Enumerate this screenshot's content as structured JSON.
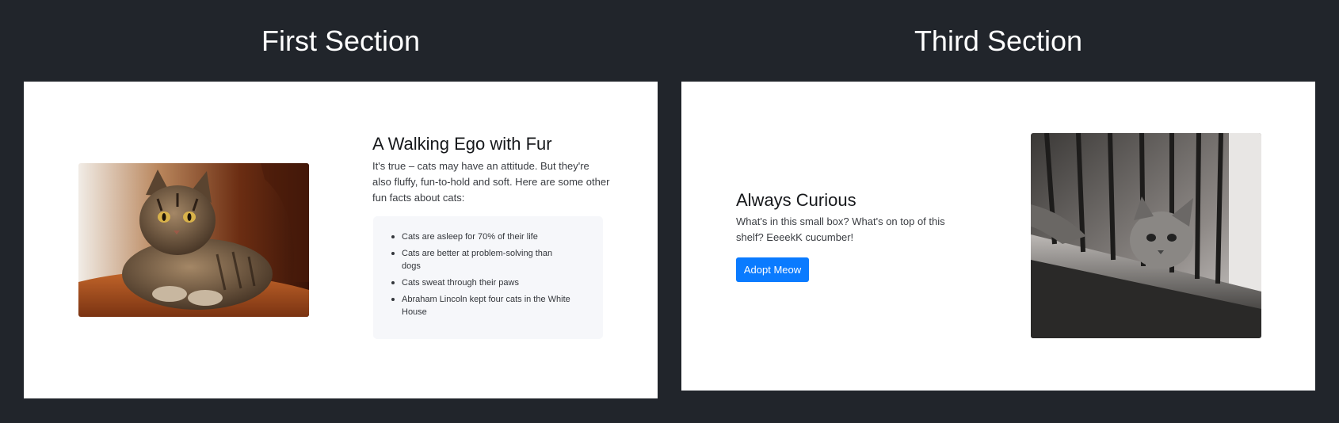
{
  "sections": {
    "first": {
      "title": "First Section",
      "image_icon": "tabby-cat-photo",
      "heading": "A Walking Ego with Fur",
      "paragraph": "It's true – cats may have an attitude. But they're also fluffy, fun-to-hold and soft. Here are some other fun facts about cats:",
      "facts": [
        "Cats are asleep for 70% of their life",
        "Cats are better at problem-solving than dogs",
        "Cats sweat through their paws",
        "Abraham Lincoln kept four cats in the White House"
      ]
    },
    "third": {
      "title": "Third Section",
      "image_icon": "balcony-cat-photo",
      "heading": "Always Curious",
      "paragraph": "What's in this small box? What's on top of this shelf? EeeekK cucumber!",
      "button_label": "Adopt Meow"
    }
  },
  "colors": {
    "background": "#21252b",
    "panel": "#ffffff",
    "facts_box": "#f6f7fa",
    "button": "#0a7bff"
  }
}
